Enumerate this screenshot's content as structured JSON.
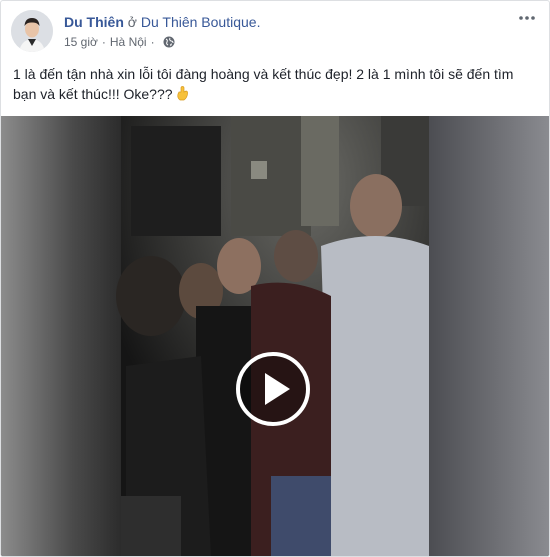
{
  "post": {
    "author_name": "Du Thiên",
    "at_word": "ở",
    "page_name": "Du Thiên Boutique.",
    "time": "15 giờ",
    "separator": "·",
    "location": "Hà Nội",
    "text": "1 là đến tận nhà xin lỗi tôi đàng hoàng và kết thúc đẹp! 2 là 1 mình tôi sẽ đến tìm bạn và kết thúc!!! Oke???",
    "emoji_icon": "crossed-fingers-icon",
    "privacy_icon": "globe-icon",
    "menu_icon": "more-options-icon"
  },
  "video": {
    "control_icon": "play-icon"
  },
  "colors": {
    "link": "#385898",
    "text": "#1d2129",
    "meta": "#616770",
    "border": "#dddfe2"
  }
}
